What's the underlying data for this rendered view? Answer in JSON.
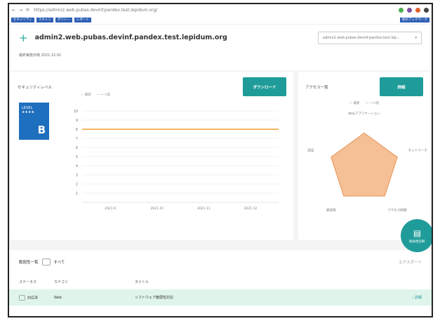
{
  "browser": {
    "url": "https://admin2.web.pubas.devinf.pandex.test.lepidum.org/",
    "nav_back": "←",
    "nav_forward": "→",
    "nav_reload": "⟳",
    "bookmarks": [
      "セキュリティ",
      "スキャン",
      "ポリシー",
      "レポート"
    ],
    "bookmark_right": "他のブックマーク"
  },
  "app": {
    "plus": "+",
    "title": "admin2.web.pubas.devinf.pandex.test.lepidum.org",
    "selector_value": "admin2.web.pubas.devinf.pandex.test.lep...",
    "selector_caret": "▾",
    "last_scan": "最終実施日時  2021.12.01"
  },
  "security_card": {
    "title": "セキュリティレベル",
    "button": "ダウンロード",
    "level_label": "LEVEL",
    "level_stars": "★★★★",
    "level_grade": "B",
    "legend": [
      "— 最新",
      "— 一つ前"
    ]
  },
  "radar_card": {
    "title": "アクセス一覧",
    "button": "詳細",
    "legend": [
      "— 最新",
      "— 一つ前"
    ],
    "axis_labels": [
      "Webアプリケーション",
      "ネットワーク",
      "アクセス制御",
      "脆弱性",
      "認証"
    ]
  },
  "chart_data": [
    {
      "type": "line",
      "x": [
        "2021.9",
        "2021.10",
        "2021.11",
        "2021.12"
      ],
      "series": [
        {
          "name": "最新",
          "values": [
            8,
            8,
            8,
            8
          ]
        }
      ],
      "ylim": [
        0,
        10
      ],
      "yticks": [
        1,
        2,
        3,
        4,
        5,
        6,
        7,
        8,
        9,
        10
      ],
      "grid": true,
      "legend_position": "top"
    },
    {
      "type": "radar",
      "categories": [
        "Webアプリケーション",
        "ネットワーク",
        "アクセス制御",
        "脆弱性",
        "認証"
      ],
      "series": [
        {
          "name": "最新",
          "values": [
            8,
            8,
            8,
            8,
            8
          ]
        }
      ],
      "ylim": [
        0,
        10
      ]
    }
  ],
  "list": {
    "header": "脆弱性一覧",
    "filter_label": "すべて",
    "export_label": "エクスポート",
    "columns": [
      "ステータス",
      "カテゴリ",
      "タイトル"
    ],
    "rows": [
      {
        "status": "対応済",
        "category": "Web",
        "title": "ソフトウェア脆弱性対応",
        "action": "› 詳細"
      }
    ]
  },
  "fab": {
    "label": "脆弱性診断"
  },
  "colors": {
    "accent": "#1f9c99",
    "level": "#1f6fbf",
    "line": "#f0a030",
    "radar": "#f5b585"
  }
}
